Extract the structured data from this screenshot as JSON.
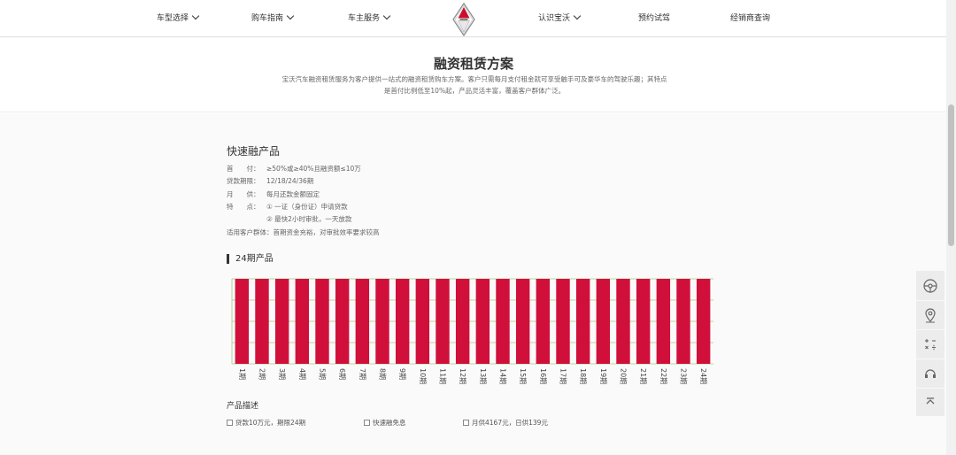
{
  "nav": {
    "items": [
      {
        "label": "车型选择",
        "has_dropdown": true
      },
      {
        "label": "购车指南",
        "has_dropdown": true
      },
      {
        "label": "车主服务",
        "has_dropdown": true
      },
      {
        "label": "认识宝沃",
        "has_dropdown": true
      },
      {
        "label": "预约试驾",
        "has_dropdown": false
      },
      {
        "label": "经销商查询",
        "has_dropdown": false
      }
    ]
  },
  "hero": {
    "title": "融资租赁方案",
    "description": "宝沃汽车融资租赁服务为客户提供一站式的融资租赁购车方案。客户只需每月支付租金就可享受触手可及豪华车的驾驶乐趣；其特点是首付比例低至10%起，产品灵活丰富，覆盖客户群体广泛。"
  },
  "product": {
    "title": "快速融产品",
    "specs": [
      {
        "label": "首　　付：",
        "value": "≥50%或≥40%且融资额≤10万"
      },
      {
        "label": "贷款期限：",
        "value": "12/18/24/36期"
      },
      {
        "label": "月　　供：",
        "value": "每月还款金额固定"
      },
      {
        "label": "特　　点：",
        "value": "① 一证（身份证）申请贷款"
      },
      {
        "label": "",
        "value": "② 最快2小时审批，一天放款"
      }
    ],
    "audience": "适用客户群体：首期资金充裕，对审批效率要求较高"
  },
  "chart_heading": "24期产品",
  "chart_data": {
    "type": "bar",
    "categories": [
      "1期",
      "2期",
      "3期",
      "4期",
      "5期",
      "6期",
      "7期",
      "8期",
      "9期",
      "10期",
      "11期",
      "12期",
      "13期",
      "14期",
      "15期",
      "16期",
      "17期",
      "18期",
      "19期",
      "20期",
      "21期",
      "22期",
      "23期",
      "24期"
    ],
    "values": [
      4167,
      4167,
      4167,
      4167,
      4167,
      4167,
      4167,
      4167,
      4167,
      4167,
      4167,
      4167,
      4167,
      4167,
      4167,
      4167,
      4167,
      4167,
      4167,
      4167,
      4167,
      4167,
      4167,
      4167
    ],
    "ylim": [
      0,
      4167
    ],
    "grid": true,
    "bar_color": "#d0103a",
    "grid_color": "#9bcf73"
  },
  "description_section": {
    "title": "产品描述",
    "items": [
      "贷款10万元，期限24期",
      "快速融免息",
      "月供4167元，日供139元"
    ]
  },
  "side_tools": [
    "steering-wheel-icon",
    "location-pin-icon",
    "calculator-icon",
    "customer-service-icon",
    "back-to-top-icon"
  ],
  "colors": {
    "accent": "#d0103a",
    "logo_red": "#c8102e"
  }
}
